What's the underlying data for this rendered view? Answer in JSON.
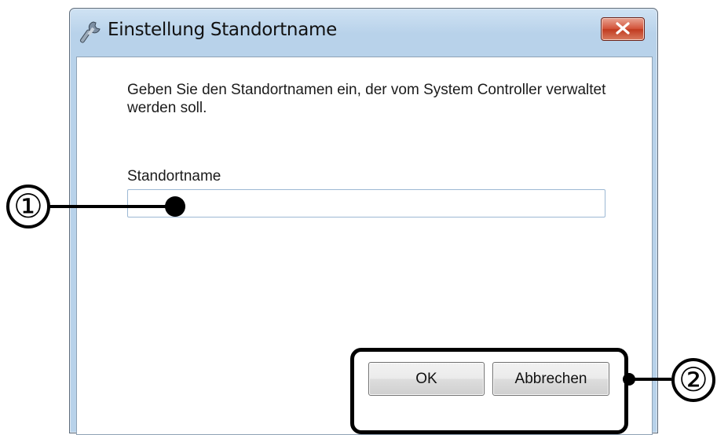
{
  "window": {
    "title": "Einstellung Standortname",
    "icon": "wrench-icon",
    "close_icon": "close-icon"
  },
  "dialog": {
    "description": "Geben Sie den Standortnamen ein, der vom System Controller verwaltet werden soll.",
    "field_label": "Standortname",
    "field_value": "",
    "ok_label": "OK",
    "cancel_label": "Abbrechen"
  },
  "annotations": {
    "callout_1": "①",
    "callout_2": "②"
  },
  "colors": {
    "title_bar": "#b8d2ea",
    "close_button": "#c13b20",
    "input_border": "#9cb8d4",
    "annotation": "#000000"
  }
}
